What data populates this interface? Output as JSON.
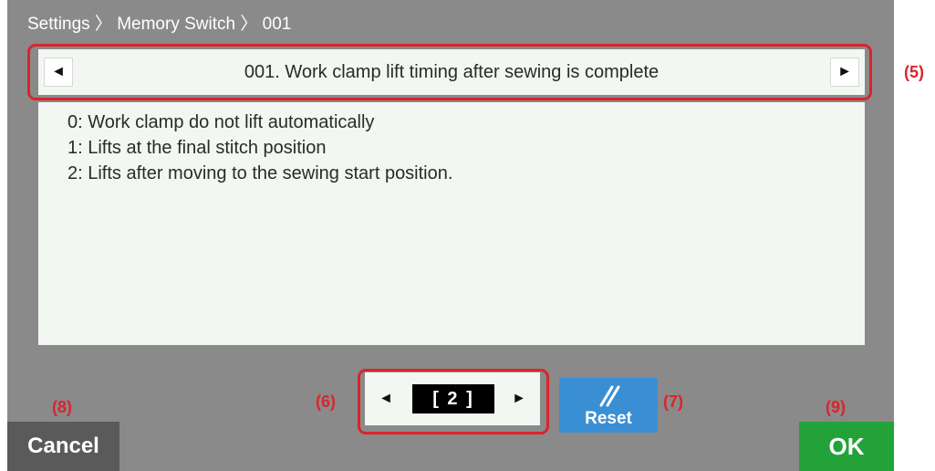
{
  "breadcrumb": {
    "text": "Settings 〉 Memory Switch 〉 001"
  },
  "header": {
    "prev_icon": "◄",
    "next_icon": "►",
    "title": "001. Work clamp lift timing after sewing is complete"
  },
  "description": {
    "lines": [
      "0: Work clamp do not lift automatically",
      "1: Lifts at the final stitch position",
      "2: Lifts after moving to the sewing start position."
    ]
  },
  "value_selector": {
    "dec_icon": "◄",
    "inc_icon": "►",
    "value": "[ 2 ]"
  },
  "reset": {
    "label": "Reset",
    "icon": "reset-slash-icon",
    "color": "#3a8fd4"
  },
  "footer": {
    "cancel_label": "Cancel",
    "ok_label": "OK",
    "cancel_color": "#5a5a5a",
    "ok_color": "#23a23a"
  },
  "callouts": {
    "c5": "(5)",
    "c6": "(6)",
    "c7": "(7)",
    "c8": "(8)",
    "c9": "(9)",
    "color": "#d9252b"
  }
}
